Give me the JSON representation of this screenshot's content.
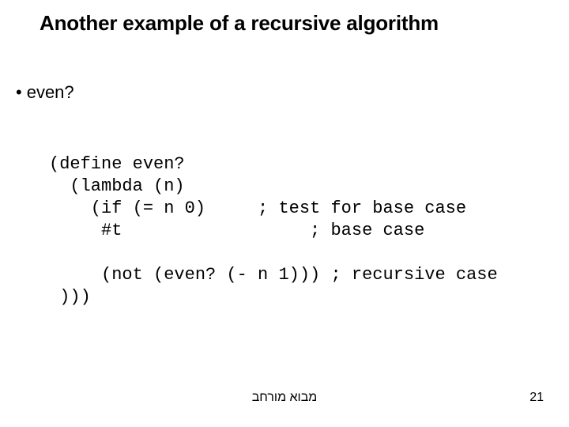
{
  "title": "Another example of a recursive algorithm",
  "bullet_dot": "•",
  "bullet_label": "even?",
  "code": {
    "l1": "(define even?",
    "l2": "  (lambda (n)",
    "l3": "    (if (= n 0)     ; test for base case",
    "l4": "     #t                  ; base case",
    "l5": "     (not (even? (- n 1))) ; recursive case",
    "l6": " )))"
  },
  "footer": "מבוא מורחב",
  "page": "21"
}
